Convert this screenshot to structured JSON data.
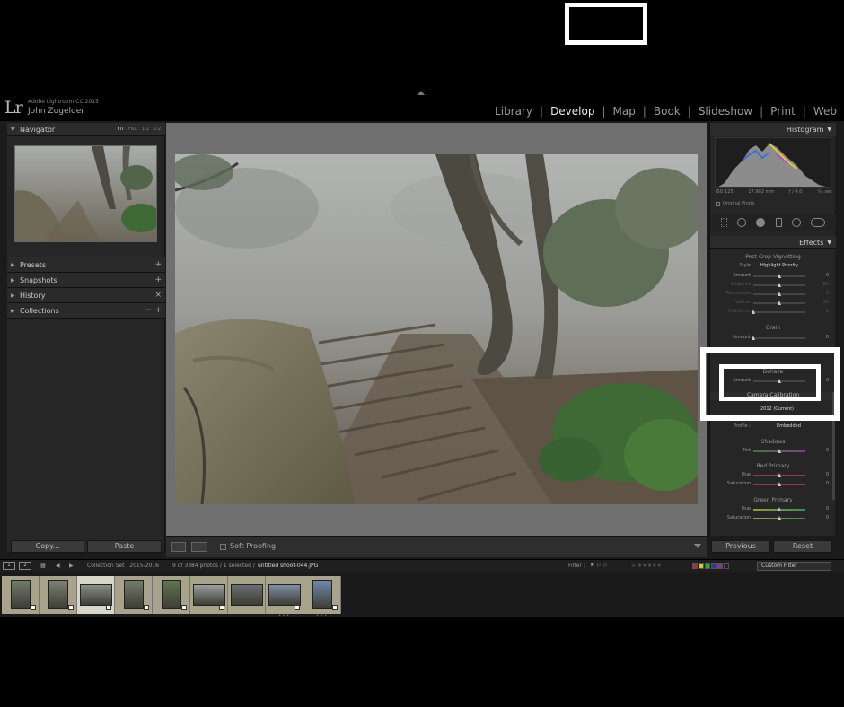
{
  "app": {
    "logo": "Lr",
    "product": "Adobe Lightroom CC 2015",
    "user": "John Zugelder"
  },
  "modules": [
    "Library",
    "Develop",
    "Map",
    "Book",
    "Slideshow",
    "Print",
    "Web"
  ],
  "active_module": "Develop",
  "left_panel": {
    "navigator": {
      "title": "Navigator",
      "modes": [
        "FIT",
        "FILL",
        "1:1",
        "1:2"
      ]
    },
    "sections": [
      {
        "label": "Presets",
        "action": "+"
      },
      {
        "label": "Snapshots",
        "action": "+"
      },
      {
        "label": "History",
        "action": "×"
      },
      {
        "label": "Collections",
        "action": "−  +"
      }
    ],
    "copy_label": "Copy...",
    "paste_label": "Paste"
  },
  "toolbar": {
    "soft_proofing_label": "Soft Proofing"
  },
  "right_panel": {
    "histogram_title": "Histogram",
    "hist_info": [
      "ISO 125",
      "17.902 mm",
      "f / 4.0",
      "¹⁄₁₅ sec"
    ],
    "original_photo_label": "Original Photo",
    "effects_title": "Effects",
    "vignetting": {
      "title": "Post-Crop Vignetting",
      "style_label": "Style",
      "style_value": "Highlight Priority",
      "sliders": [
        {
          "label": "Amount",
          "value": "0",
          "pos": 0.5
        },
        {
          "label": "Midpoint",
          "value": "50",
          "pos": 0.5,
          "dim": true
        },
        {
          "label": "Roundness",
          "value": "0",
          "pos": 0.5,
          "dim": true
        },
        {
          "label": "Feather",
          "value": "50",
          "pos": 0.5,
          "dim": true
        },
        {
          "label": "Highlights",
          "value": "0",
          "pos": 0.0,
          "dim": true
        }
      ]
    },
    "grain": {
      "title": "Grain",
      "sliders": [
        {
          "label": "Amount",
          "value": "0",
          "pos": 0.0
        }
      ]
    },
    "dehaze": {
      "title": "Dehaze",
      "sliders": [
        {
          "label": "Amount",
          "value": "0",
          "pos": 0.5
        }
      ]
    },
    "camera_calibration": {
      "title": "Camera Calibration",
      "process_value": "2012 (Current)",
      "profile_label": "Profile :",
      "profile_value": "Embedded",
      "shadows_title": "Shadows",
      "shadows": [
        {
          "label": "Tint",
          "value": "0",
          "pos": 0.5
        }
      ],
      "red_title": "Red Primary",
      "red": [
        {
          "label": "Hue",
          "value": "0",
          "pos": 0.5
        },
        {
          "label": "Saturation",
          "value": "0",
          "pos": 0.5
        }
      ],
      "green_title": "Green Primary",
      "green": [
        {
          "label": "Hue",
          "value": "0",
          "pos": 0.5
        },
        {
          "label": "Saturation",
          "value": "0",
          "pos": 0.5
        }
      ]
    },
    "previous_label": "Previous",
    "reset_label": "Reset"
  },
  "filmstrip_bar": {
    "monitor_1": "1",
    "monitor_2": "2",
    "collection": "Collection Set : 2015-2016",
    "count": "9 of 3384 photos / 1 selected /",
    "filename": "untitled shoot-044.JPG",
    "filter_label": "Filter :",
    "filter_preset": "Custom Filter"
  },
  "colors": {
    "accent_white": "#ffffff",
    "panel_bg": "#262626",
    "filmstrip_cell": "#a8a48c"
  },
  "filmstrip": {
    "thumbs": [
      {
        "orient": "portrait",
        "tone": "#6f7a68",
        "badge": true
      },
      {
        "orient": "portrait",
        "tone": "#7c7f74",
        "badge": true
      },
      {
        "orient": "landscape",
        "tone": "#8a8d88",
        "badge": true,
        "selected": true
      },
      {
        "orient": "portrait",
        "tone": "#707a6a",
        "badge": true
      },
      {
        "orient": "portrait",
        "tone": "#5f7450",
        "badge": true
      },
      {
        "orient": "landscape",
        "tone": "#9aa0a0",
        "badge": true
      },
      {
        "orient": "landscape",
        "tone": "#6a6e72",
        "badge": false
      },
      {
        "orient": "landscape",
        "tone": "#7f8fa4",
        "badge": true,
        "dots": "•••"
      },
      {
        "orient": "portrait",
        "tone": "#6f87a8",
        "badge": true,
        "dots": "•••"
      }
    ]
  }
}
